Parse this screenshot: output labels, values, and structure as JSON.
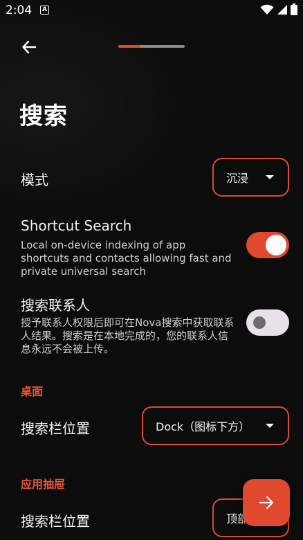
{
  "status_bar": {
    "time": "2:04",
    "notification_icon": "A",
    "icons": [
      "wifi-icon",
      "signal-icon",
      "battery-icon"
    ]
  },
  "app_bar": {
    "back_icon": "arrow-left-icon",
    "progress_fraction": 0.33
  },
  "page": {
    "title": "搜索"
  },
  "mode_row": {
    "label": "模式",
    "value": "沉浸"
  },
  "shortcut_search": {
    "label": "Shortcut Search",
    "description": "Local on-device indexing of app shortcuts and contacts allowing fast and private universal search",
    "enabled": true
  },
  "contacts_search": {
    "label": "搜索联系人",
    "description": "授予联系人权限后即可在Nova搜索中获取联系人结果。搜索是在本地完成的，您的联系人信息永远不会被上传。",
    "enabled": false
  },
  "desktop_section": {
    "header": "桌面",
    "searchbar_label": "搜索栏位置",
    "searchbar_value": "Dock（图标下方）"
  },
  "drawer_section": {
    "header": "应用抽屉",
    "searchbar_label": "搜索栏位置",
    "searchbar_value": "顶部"
  },
  "fab": {
    "icon": "arrow-right-icon"
  },
  "colors": {
    "accent": "#e0492d",
    "background": "#0c0c0c"
  }
}
